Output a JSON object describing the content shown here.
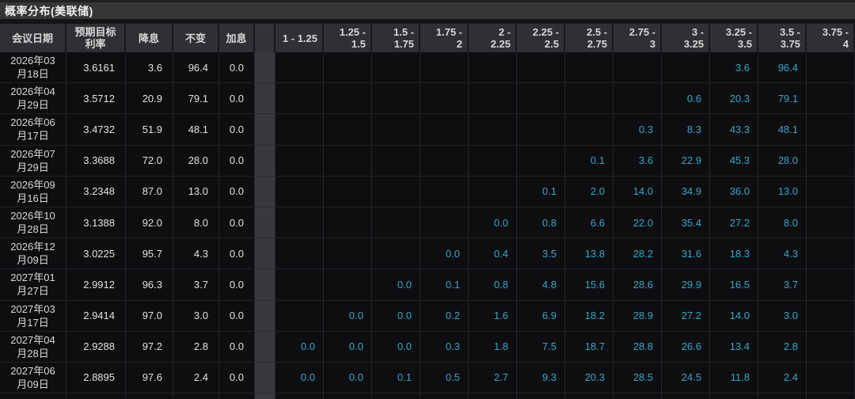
{
  "title": "概率分布(美联储)",
  "colors": {
    "accent_cyan": "#35a6c9",
    "header_bg": "#2e3033",
    "cell_bg": "#0e0e10",
    "separator_bg": "#39383e",
    "title_bar_bg": "#353638"
  },
  "table": {
    "fixed_headers": [
      {
        "key": "date",
        "label": "会议日期"
      },
      {
        "key": "target",
        "label": "预期目标\n利率"
      },
      {
        "key": "cut",
        "label": "降息"
      },
      {
        "key": "hold",
        "label": "不变"
      },
      {
        "key": "hike",
        "label": "加息"
      }
    ],
    "range_headers": [
      "1 - 1.25",
      "1.25 -\n1.5",
      "1.5 -\n1.75",
      "1.75 -\n2",
      "2 -\n2.25",
      "2.25 -\n2.5",
      "2.5 -\n2.75",
      "2.75 -\n3",
      "3 -\n3.25",
      "3.25 -\n3.5",
      "3.5 -\n3.75",
      "3.75 -\n4"
    ],
    "rows": [
      {
        "date": "2026年03\n月18日",
        "target": "3.6161",
        "cut": "3.6",
        "hold": "96.4",
        "hike": "0.0",
        "probs": [
          "",
          "",
          "",
          "",
          "",
          "",
          "",
          "",
          "",
          "3.6",
          "96.4",
          ""
        ]
      },
      {
        "date": "2026年04\n月29日",
        "target": "3.5712",
        "cut": "20.9",
        "hold": "79.1",
        "hike": "0.0",
        "probs": [
          "",
          "",
          "",
          "",
          "",
          "",
          "",
          "",
          "0.6",
          "20.3",
          "79.1",
          ""
        ]
      },
      {
        "date": "2026年06\n月17日",
        "target": "3.4732",
        "cut": "51.9",
        "hold": "48.1",
        "hike": "0.0",
        "probs": [
          "",
          "",
          "",
          "",
          "",
          "",
          "",
          "0.3",
          "8.3",
          "43.3",
          "48.1",
          ""
        ]
      },
      {
        "date": "2026年07\n月29日",
        "target": "3.3688",
        "cut": "72.0",
        "hold": "28.0",
        "hike": "0.0",
        "probs": [
          "",
          "",
          "",
          "",
          "",
          "",
          "0.1",
          "3.6",
          "22.9",
          "45.3",
          "28.0",
          ""
        ]
      },
      {
        "date": "2026年09\n月16日",
        "target": "3.2348",
        "cut": "87.0",
        "hold": "13.0",
        "hike": "0.0",
        "probs": [
          "",
          "",
          "",
          "",
          "",
          "0.1",
          "2.0",
          "14.0",
          "34.9",
          "36.0",
          "13.0",
          ""
        ]
      },
      {
        "date": "2026年10\n月28日",
        "target": "3.1388",
        "cut": "92.0",
        "hold": "8.0",
        "hike": "0.0",
        "probs": [
          "",
          "",
          "",
          "",
          "0.0",
          "0.8",
          "6.6",
          "22.0",
          "35.4",
          "27.2",
          "8.0",
          ""
        ]
      },
      {
        "date": "2026年12\n月09日",
        "target": "3.0225",
        "cut": "95.7",
        "hold": "4.3",
        "hike": "0.0",
        "probs": [
          "",
          "",
          "",
          "0.0",
          "0.4",
          "3.5",
          "13.8",
          "28.2",
          "31.6",
          "18.3",
          "4.3",
          ""
        ]
      },
      {
        "date": "2027年01\n月27日",
        "target": "2.9912",
        "cut": "96.3",
        "hold": "3.7",
        "hike": "0.0",
        "probs": [
          "",
          "",
          "0.0",
          "0.1",
          "0.8",
          "4.8",
          "15.6",
          "28.6",
          "29.9",
          "16.5",
          "3.7",
          ""
        ]
      },
      {
        "date": "2027年03\n月17日",
        "target": "2.9414",
        "cut": "97.0",
        "hold": "3.0",
        "hike": "0.0",
        "probs": [
          "",
          "0.0",
          "0.0",
          "0.2",
          "1.6",
          "6.9",
          "18.2",
          "28.9",
          "27.2",
          "14.0",
          "3.0",
          ""
        ]
      },
      {
        "date": "2027年04\n月28日",
        "target": "2.9288",
        "cut": "97.2",
        "hold": "2.8",
        "hike": "0.0",
        "probs": [
          "0.0",
          "0.0",
          "0.0",
          "0.3",
          "1.8",
          "7.5",
          "18.7",
          "28.8",
          "26.6",
          "13.4",
          "2.8",
          ""
        ]
      },
      {
        "date": "2027年06\n月09日",
        "target": "2.8895",
        "cut": "97.6",
        "hold": "2.4",
        "hike": "0.0",
        "probs": [
          "0.0",
          "0.0",
          "0.1",
          "0.5",
          "2.7",
          "9.3",
          "20.3",
          "28.5",
          "24.5",
          "11.8",
          "2.4",
          ""
        ]
      }
    ]
  }
}
